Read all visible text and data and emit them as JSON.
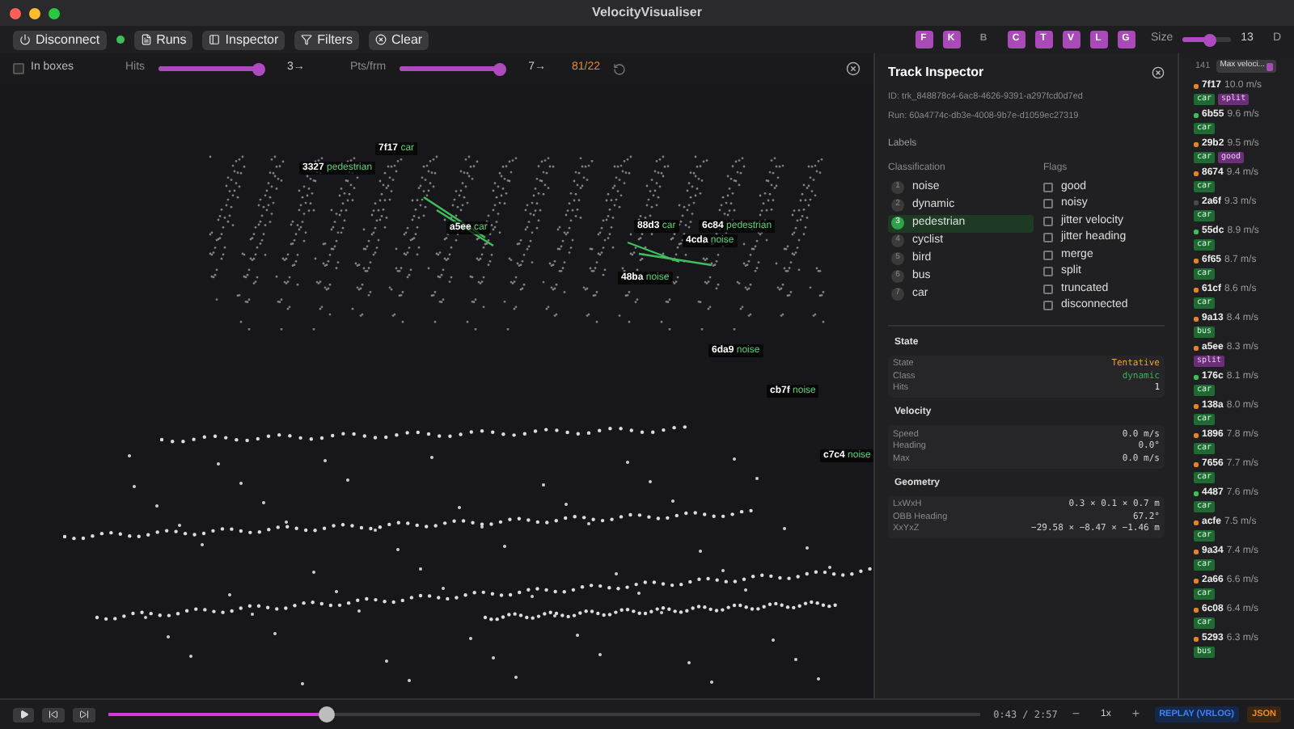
{
  "window": {
    "title": "VelocityVisualiser"
  },
  "toolbar": {
    "buttons": [
      {
        "kind": "disconnect",
        "label": "Disconnect"
      },
      {
        "kind": "runs",
        "label": "Runs"
      },
      {
        "kind": "inspector",
        "label": "Inspector"
      },
      {
        "kind": "filters",
        "label": "Filters"
      },
      {
        "kind": "clear",
        "label": "Clear"
      }
    ],
    "connected": true,
    "class_toggles": [
      {
        "label": "F",
        "selected": true
      },
      {
        "label": "K",
        "selected": true
      },
      {
        "label": "B",
        "selected": false
      },
      {
        "label": "C",
        "selected": true
      },
      {
        "label": "T",
        "selected": true
      },
      {
        "label": "V",
        "selected": true
      },
      {
        "label": "L",
        "selected": true
      },
      {
        "label": "G",
        "selected": true
      }
    ],
    "size": {
      "label": "Size",
      "level": 0.55,
      "value": "13"
    },
    "mode": "D"
  },
  "filters": {
    "in_boxes": {
      "label": "In boxes",
      "checked": false
    },
    "hits": {
      "label": "Hits",
      "level": 1,
      "value": "3→"
    },
    "pts": {
      "label": "Pts/frm",
      "level": 1,
      "value": "7→"
    },
    "count": "81/22"
  },
  "canvas_labels": [
    {
      "id": "7f17",
      "class": "car"
    },
    {
      "id": "3327",
      "class": "pedestrian"
    },
    {
      "id": "a5ee",
      "class": "car"
    },
    {
      "id": "88d3",
      "class": "car"
    },
    {
      "id": "6c84",
      "class": "pedestrian"
    },
    {
      "id": "4cda",
      "class": "noise"
    },
    {
      "id": "48ba",
      "class": "noise"
    },
    {
      "id": "6da9",
      "class": "noise"
    },
    {
      "id": "cb7f",
      "class": "noise"
    },
    {
      "id": "c7c4",
      "class": "noise"
    }
  ],
  "inspector": {
    "title": "Track Inspector",
    "id": "ID: trk_848878c4-6ac8-4626-9391-a297fcd0d7ed",
    "run": "Run: 60a4774c-db3e-4008-9b7e-d1059ec27319",
    "labels_heading": "Labels",
    "classification_heading": "Classification",
    "flags_heading": "Flags",
    "classes": [
      {
        "num": "1",
        "label": "noise",
        "selected": false
      },
      {
        "num": "2",
        "label": "dynamic",
        "selected": false
      },
      {
        "num": "3",
        "label": "pedestrian",
        "selected": true
      },
      {
        "num": "4",
        "label": "cyclist",
        "selected": false
      },
      {
        "num": "5",
        "label": "bird",
        "selected": false
      },
      {
        "num": "6",
        "label": "bus",
        "selected": false
      },
      {
        "num": "7",
        "label": "car",
        "selected": false
      }
    ],
    "flags": [
      {
        "label": "good",
        "checked": false
      },
      {
        "label": "noisy",
        "checked": false
      },
      {
        "label": "jitter velocity",
        "checked": false
      },
      {
        "label": "jitter heading",
        "checked": false
      },
      {
        "label": "merge",
        "checked": false
      },
      {
        "label": "split",
        "checked": false
      },
      {
        "label": "truncated",
        "checked": false
      },
      {
        "label": "disconnected",
        "checked": false
      }
    ],
    "sections": [
      {
        "title": "State",
        "rows": [
          {
            "label": "State",
            "value": "Tentative",
            "color": "#e8a33a"
          },
          {
            "label": "Class",
            "value": "dynamic",
            "color": "#3fae5a"
          },
          {
            "label": "Hits",
            "value": "1",
            "color": "#e6e6e6"
          }
        ]
      },
      {
        "title": "Velocity",
        "rows": [
          {
            "label": "Speed",
            "value": "0.0 m/s",
            "color": "#d0d0d0"
          },
          {
            "label": "Heading",
            "value": "0.0°",
            "color": "#d0d0d0"
          },
          {
            "label": "Max",
            "value": "0.0 m/s",
            "color": "#d0d0d0"
          }
        ]
      },
      {
        "title": "Geometry",
        "rows": [
          {
            "label": "LxWxH",
            "value": "0.3 × 0.1 × 0.7 m",
            "color": "#d0d0d0"
          },
          {
            "label": "OBB Heading",
            "value": "67.2°",
            "color": "#d0d0d0"
          },
          {
            "label": "XxYxZ",
            "value": "−29.58 × −8.47 × −1.46 m",
            "color": "#d0d0d0"
          }
        ]
      }
    ]
  },
  "track_list": {
    "count": "141",
    "sort": "Max veloci...",
    "tracks": [
      {
        "id": "7f17",
        "speed": "10.0 m/s",
        "color": "#e0842c",
        "tags": [
          {
            "label": "car",
            "kind": "class"
          },
          {
            "label": "split",
            "kind": "flag"
          }
        ]
      },
      {
        "id": "6b55",
        "speed": "9.6 m/s",
        "color": "#3fbf5a",
        "tags": [
          {
            "label": "car",
            "kind": "class"
          }
        ]
      },
      {
        "id": "29b2",
        "speed": "9.5 m/s",
        "color": "#e0842c",
        "tags": [
          {
            "label": "car",
            "kind": "class"
          },
          {
            "label": "good",
            "kind": "flag"
          }
        ]
      },
      {
        "id": "8674",
        "speed": "9.4 m/s",
        "color": "#e0842c",
        "tags": [
          {
            "label": "car",
            "kind": "class"
          }
        ]
      },
      {
        "id": "2a6f",
        "speed": "9.3 m/s",
        "color": "#4a4a4a",
        "tags": [
          {
            "label": "car",
            "kind": "class"
          }
        ]
      },
      {
        "id": "55dc",
        "speed": "8.9 m/s",
        "color": "#3fbf5a",
        "tags": [
          {
            "label": "car",
            "kind": "class"
          }
        ]
      },
      {
        "id": "6f65",
        "speed": "8.7 m/s",
        "color": "#e0842c",
        "tags": [
          {
            "label": "car",
            "kind": "class"
          }
        ]
      },
      {
        "id": "61cf",
        "speed": "8.6 m/s",
        "color": "#e0842c",
        "tags": [
          {
            "label": "car",
            "kind": "class"
          }
        ]
      },
      {
        "id": "9a13",
        "speed": "8.4 m/s",
        "color": "#e0842c",
        "tags": [
          {
            "label": "bus",
            "kind": "class"
          }
        ]
      },
      {
        "id": "a5ee",
        "speed": "8.3 m/s",
        "color": "#e0842c",
        "tags": [
          {
            "label": "split",
            "kind": "flag"
          }
        ]
      },
      {
        "id": "176c",
        "speed": "8.1 m/s",
        "color": "#3fbf5a",
        "tags": [
          {
            "label": "car",
            "kind": "class"
          }
        ]
      },
      {
        "id": "138a",
        "speed": "8.0 m/s",
        "color": "#e0842c",
        "tags": [
          {
            "label": "car",
            "kind": "class"
          }
        ]
      },
      {
        "id": "1896",
        "speed": "7.8 m/s",
        "color": "#e0842c",
        "tags": [
          {
            "label": "car",
            "kind": "class"
          }
        ]
      },
      {
        "id": "7656",
        "speed": "7.7 m/s",
        "color": "#e0842c",
        "tags": [
          {
            "label": "car",
            "kind": "class"
          }
        ]
      },
      {
        "id": "4487",
        "speed": "7.6 m/s",
        "color": "#3fbf5a",
        "tags": [
          {
            "label": "car",
            "kind": "class"
          }
        ]
      },
      {
        "id": "acfe",
        "speed": "7.5 m/s",
        "color": "#e0842c",
        "tags": [
          {
            "label": "car",
            "kind": "class"
          }
        ]
      },
      {
        "id": "9a34",
        "speed": "7.4 m/s",
        "color": "#e0842c",
        "tags": [
          {
            "label": "car",
            "kind": "class"
          }
        ]
      },
      {
        "id": "2a66",
        "speed": "6.6 m/s",
        "color": "#e0842c",
        "tags": [
          {
            "label": "car",
            "kind": "class"
          }
        ]
      },
      {
        "id": "6c08",
        "speed": "6.4 m/s",
        "color": "#e0842c",
        "tags": [
          {
            "label": "car",
            "kind": "class"
          }
        ]
      },
      {
        "id": "5293",
        "speed": "6.3 m/s",
        "color": "#e0842c",
        "tags": [
          {
            "label": "bus",
            "kind": "class"
          }
        ]
      }
    ]
  },
  "playback": {
    "playing": false,
    "level": 0.25,
    "time": "0:43 / 2:57",
    "minus": "−",
    "rate": "1x",
    "plus": "+",
    "source": "REPLAY (VRLOG)",
    "export": "JSON"
  }
}
